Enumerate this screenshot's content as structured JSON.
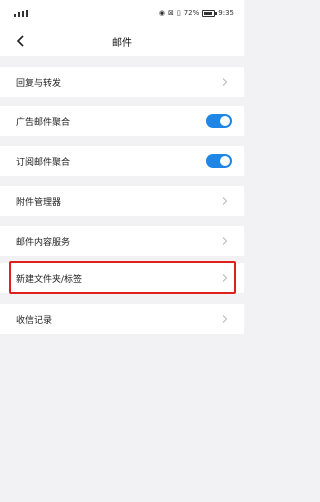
{
  "status_bar": {
    "left_text": "all",
    "battery_text": "72%",
    "time": "9:35",
    "battery_level": 0.72
  },
  "header": {
    "title": "邮件",
    "back_icon": "chevron-left-icon"
  },
  "settings": [
    {
      "label": "回复与转发",
      "control": "chevron"
    },
    {
      "label": "广告邮件聚合",
      "control": "toggle",
      "on": true
    },
    {
      "label": "订阅邮件聚合",
      "control": "toggle",
      "on": true
    },
    {
      "label": "附件管理器",
      "control": "chevron"
    },
    {
      "label": "邮件内容服务",
      "control": "chevron"
    },
    {
      "label": "新建文件夹/标签",
      "control": "chevron",
      "highlighted": true
    },
    {
      "label": "收信记录",
      "control": "chevron"
    }
  ],
  "colors": {
    "toggle_on": "#1f86e6",
    "highlight_border": "#e0201b",
    "background": "#f2f2f4"
  }
}
